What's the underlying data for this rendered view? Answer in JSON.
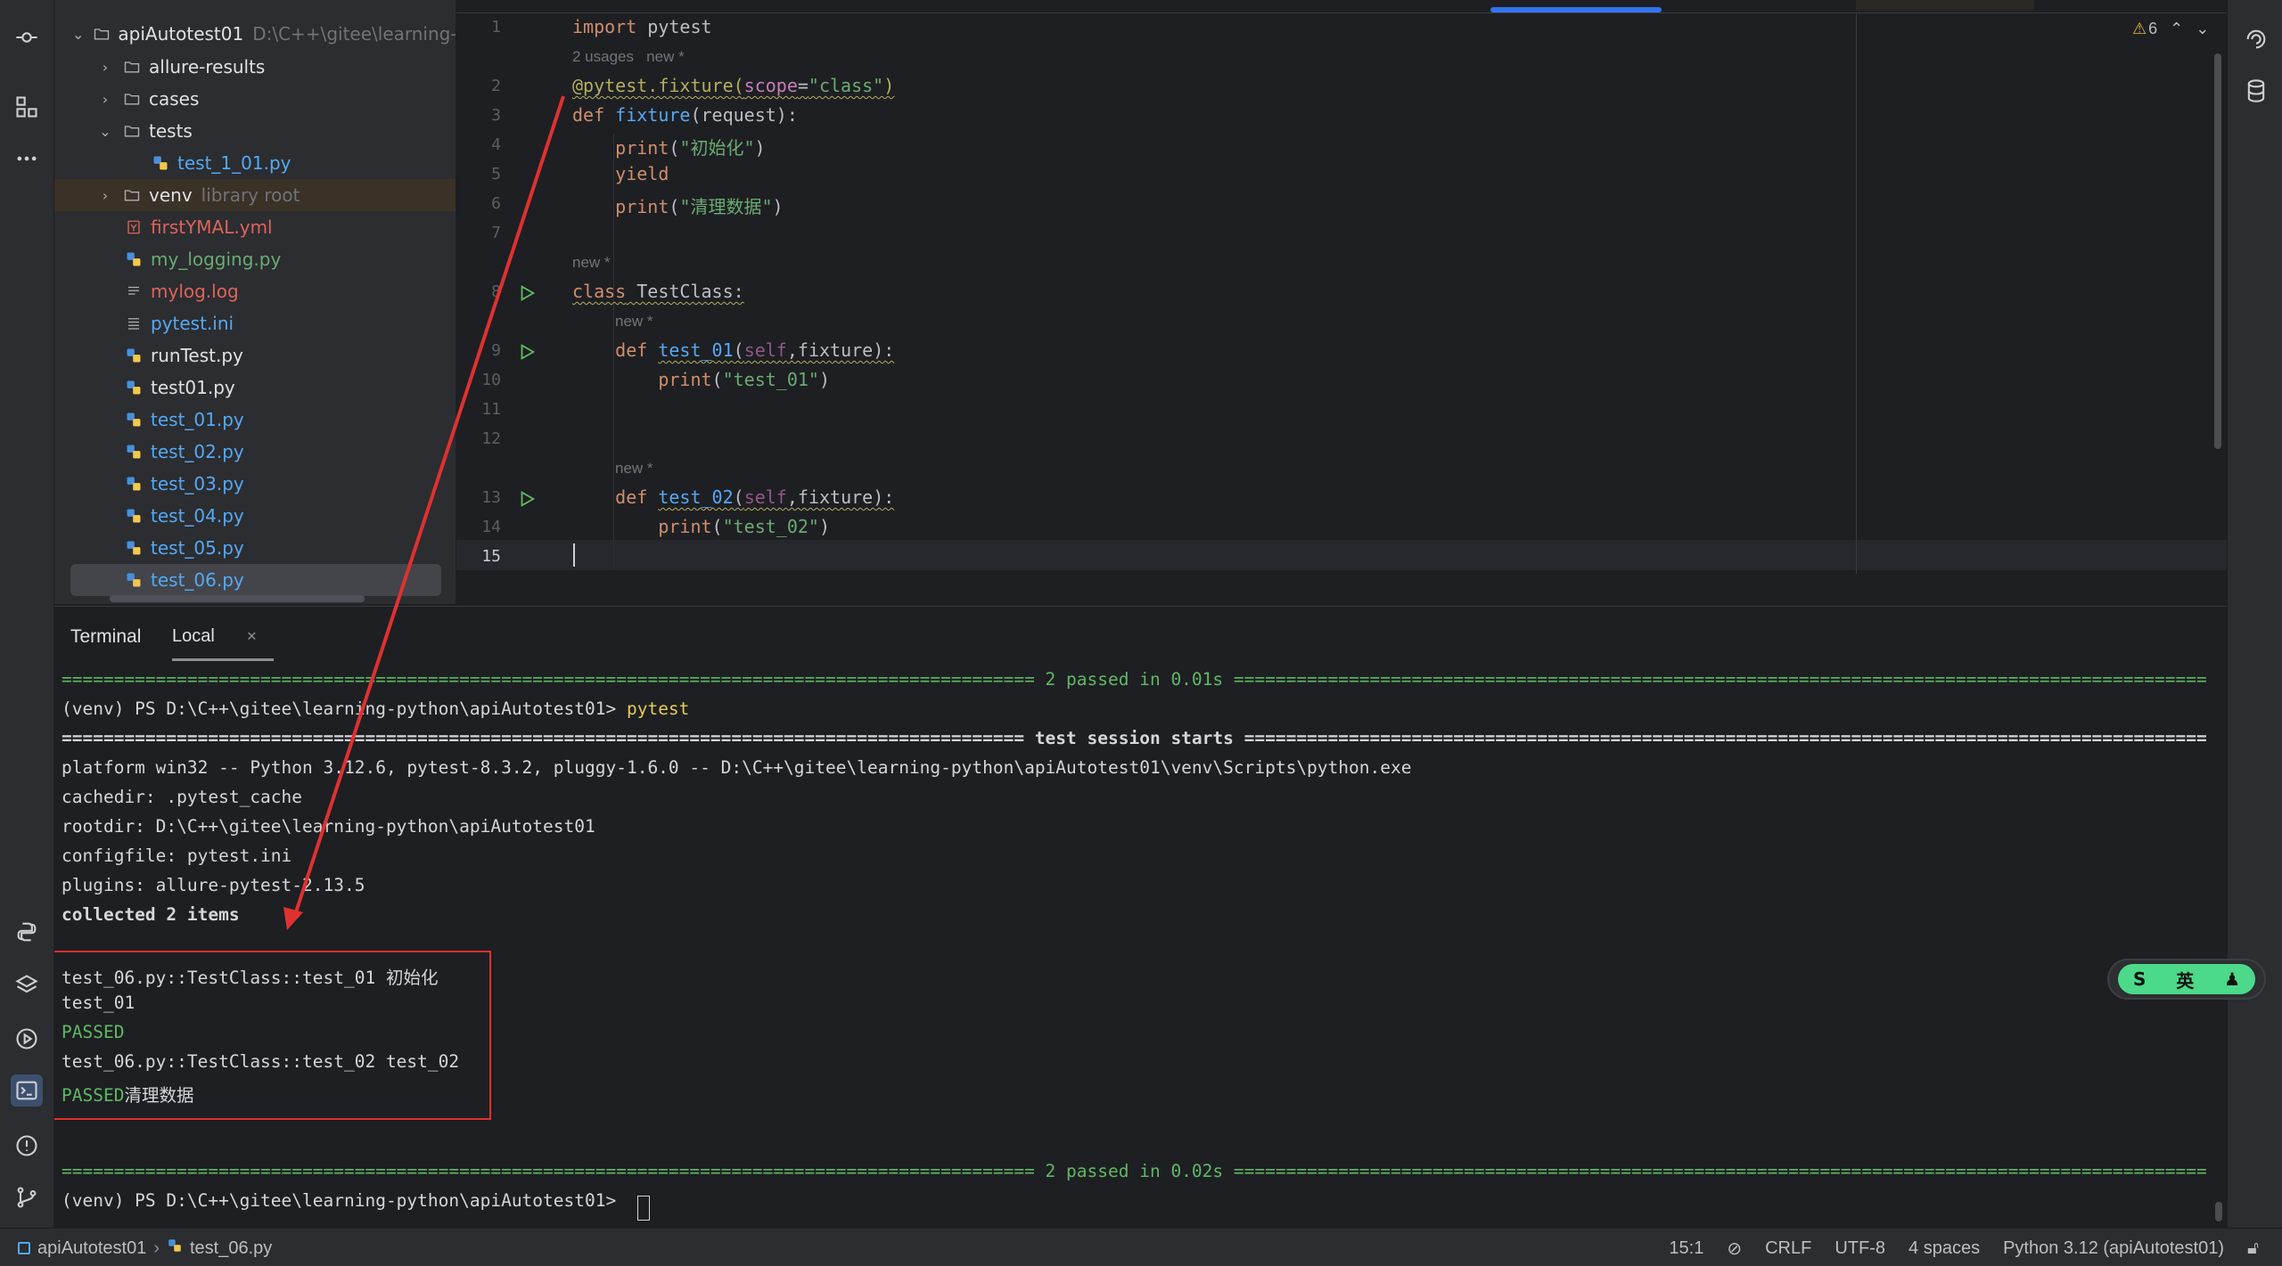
{
  "project": {
    "root_name": "apiAutotest01",
    "root_path": "D:\\C++\\gitee\\learning-p",
    "items": [
      {
        "label": "allure-results",
        "hint": ""
      },
      {
        "label": "cases",
        "hint": ""
      },
      {
        "label": "tests",
        "hint": ""
      },
      {
        "label": "test_1_01.py",
        "hint": ""
      },
      {
        "label": "venv",
        "hint": "library root"
      },
      {
        "label": "firstYMAL.yml",
        "hint": ""
      },
      {
        "label": "my_logging.py",
        "hint": ""
      },
      {
        "label": "mylog.log",
        "hint": ""
      },
      {
        "label": "pytest.ini",
        "hint": ""
      },
      {
        "label": "runTest.py",
        "hint": ""
      },
      {
        "label": "test01.py",
        "hint": ""
      },
      {
        "label": "test_01.py",
        "hint": ""
      },
      {
        "label": "test_02.py",
        "hint": ""
      },
      {
        "label": "test_03.py",
        "hint": ""
      },
      {
        "label": "test_04.py",
        "hint": ""
      },
      {
        "label": "test_05.py",
        "hint": ""
      },
      {
        "label": "test_06.py",
        "hint": ""
      }
    ]
  },
  "editor": {
    "line_numbers": [
      "1",
      "2",
      "3",
      "4",
      "5",
      "6",
      "7",
      "8",
      "9",
      "10",
      "11",
      "12",
      "13",
      "14",
      "15"
    ],
    "hints": {
      "h1_usages": "2 usages",
      "h1_new": "new *",
      "h2": "new *",
      "h3": "new *",
      "h4": "new *"
    },
    "code": {
      "l1_kw": "import",
      "l1_rest": " pytest",
      "l2_deco": "@pytest.fixture(",
      "l2_param": "scope",
      "l2_eq": "=",
      "l2_str": "\"class\"",
      "l2_close": ")",
      "l3_kw": "def",
      "l3_fn": "fixture",
      "l3_rest": "(request):",
      "l4_fn": "print",
      "l4_open": "(",
      "l4_str": "\"初始化\"",
      "l4_close": ")",
      "l5_kw": "yield",
      "l6_fn": "print",
      "l6_open": "(",
      "l6_str": "\"清理数据\"",
      "l6_close": ")",
      "l8_kw": "class",
      "l8_rest": " TestClass:",
      "l9_kw": "def",
      "l9_fn": "test_01",
      "l9_open": "(",
      "l9_self": "self",
      "l9_rest": ",fixture):",
      "l10_fn": "print",
      "l10_open": "(",
      "l10_str": "\"test_01\"",
      "l10_close": ")",
      "l13_kw": "def",
      "l13_fn": "test_02",
      "l13_open": "(",
      "l13_self": "self",
      "l13_rest": ",fixture):",
      "l14_fn": "print",
      "l14_open": "(",
      "l14_str": "\"test_02\"",
      "l14_close": ")"
    },
    "inspection_count": "6",
    "accent_color": "#3574f0"
  },
  "terminal": {
    "title": "Terminal",
    "tab": "Local",
    "lines": {
      "t1": "============================================================================================= 2 passed in 0.01s =============================================================================================",
      "t2_prompt": "(venv) PS D:\\C++\\gitee\\learning-python\\apiAutotest01> ",
      "t2_cmd": "pytest",
      "t3": "============================================================================================ test session starts ============================================================================================",
      "t4": "platform win32 -- Python 3.12.6, pytest-8.3.2, pluggy-1.6.0 -- D:\\C++\\gitee\\learning-python\\apiAutotest01\\venv\\Scripts\\python.exe",
      "t5": "cachedir: .pytest_cache",
      "t6": "rootdir: D:\\C++\\gitee\\learning-python\\apiAutotest01",
      "t7": "configfile: pytest.ini",
      "t8": "plugins: allure-pytest-2.13.5",
      "t9": "collected 2 items",
      "t10": "test_06.py::TestClass::test_01 初始化",
      "t11": "test_01",
      "t12": "PASSED",
      "t13": "test_06.py::TestClass::test_02 test_02",
      "t14_a": "PASSED",
      "t14_b": "清理数据",
      "t15": "============================================================================================= 2 passed in 0.02s =============================================================================================",
      "t16": "(venv) PS D:\\C++\\gitee\\learning-python\\apiAutotest01> "
    },
    "annotation_color": "#e03131"
  },
  "ime": {
    "label": "英"
  },
  "status": {
    "crumb_project": "apiAutotest01",
    "crumb_file": "test_06.py",
    "position": "15:1",
    "line_sep": "CRLF",
    "encoding": "UTF-8",
    "indent": "4 spaces",
    "interpreter": "Python 3.12 (apiAutotest01)"
  }
}
